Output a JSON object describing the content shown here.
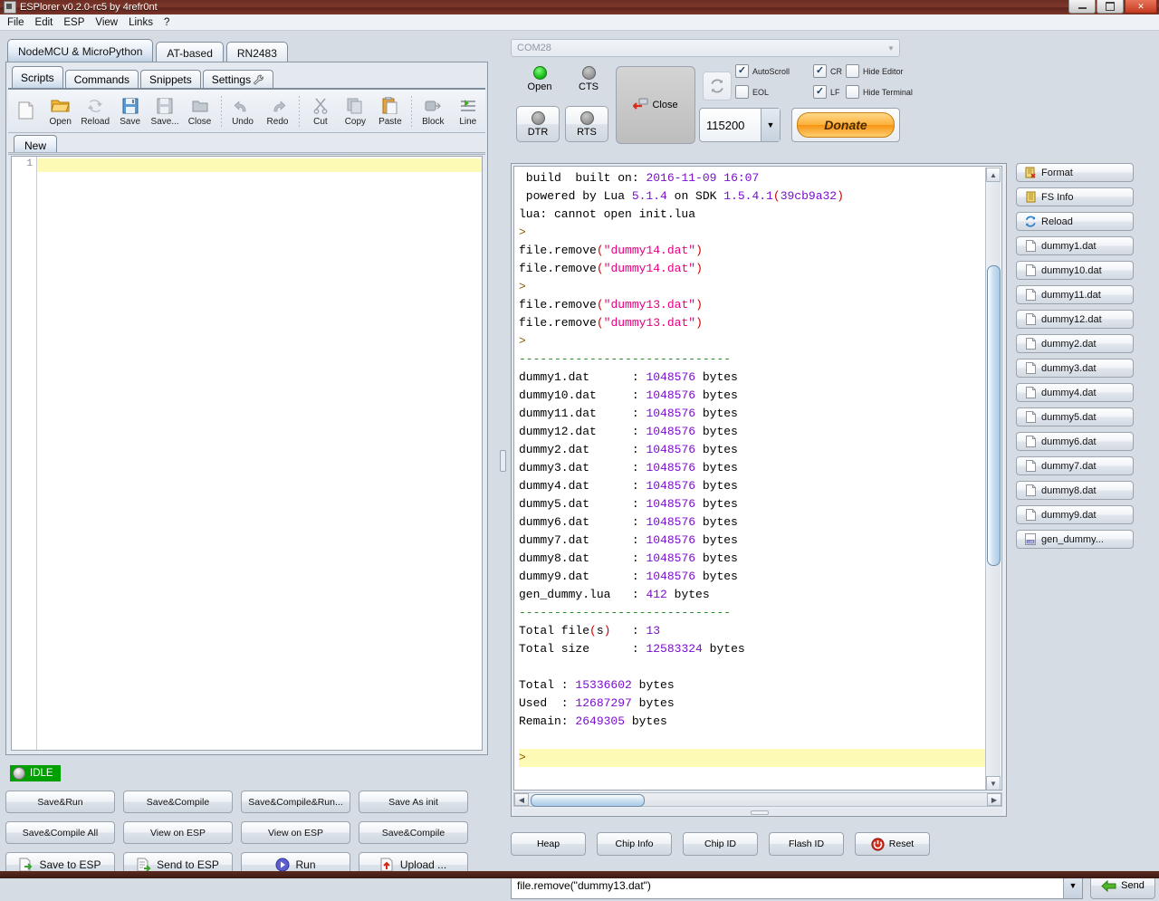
{
  "window": {
    "title": "ESPlorer v0.2.0-rc5 by 4refr0nt",
    "icon": "app-icon",
    "minimize": "minimize-button",
    "maximize": "maximize-button",
    "close": "close-button"
  },
  "menu": {
    "items": [
      "File",
      "Edit",
      "ESP",
      "View",
      "Links",
      "?"
    ]
  },
  "left": {
    "top_tabs": [
      {
        "label": "NodeMCU & MicroPython",
        "active": true
      },
      {
        "label": "AT-based",
        "active": false
      },
      {
        "label": "RN2483",
        "active": false
      }
    ],
    "sub_tabs": [
      {
        "label": "Scripts",
        "active": true
      },
      {
        "label": "Commands",
        "active": false
      },
      {
        "label": "Snippets",
        "active": false
      },
      {
        "label": "Settings",
        "active": false,
        "icon": "wrench-icon"
      }
    ],
    "toolbar": [
      {
        "label": "",
        "icon": "new-file-icon"
      },
      {
        "label": "Open",
        "icon": "open-folder-icon"
      },
      {
        "label": "Reload",
        "icon": "reload-icon"
      },
      {
        "label": "Save",
        "icon": "floppy-save-icon"
      },
      {
        "label": "Save...",
        "icon": "save-as-icon"
      },
      {
        "label": "Close",
        "icon": "close-file-icon"
      },
      {
        "label": "Undo",
        "icon": "undo-arrow-icon"
      },
      {
        "label": "Redo",
        "icon": "redo-arrow-icon"
      },
      {
        "label": "Cut",
        "icon": "scissors-icon"
      },
      {
        "label": "Copy",
        "icon": "copy-icon"
      },
      {
        "label": "Paste",
        "icon": "clipboard-paste-icon"
      },
      {
        "label": "Block",
        "icon": "block-icon"
      },
      {
        "label": "Line",
        "icon": "line-icon"
      }
    ],
    "editor_tabs": [
      {
        "label": "New",
        "active": true
      }
    ],
    "editor": {
      "line_numbers": [
        "1"
      ],
      "content": ""
    },
    "status": {
      "label": "IDLE",
      "color": "#00a000",
      "indicator": "status-led"
    },
    "buttons_row1": [
      "Save&Run",
      "Save&Compile",
      "Save&Compile&Run...",
      "Save As init"
    ],
    "buttons_row2": [
      "Save&Compile All",
      "View on ESP",
      "View on ESP",
      "Save&Compile"
    ],
    "buttons_row3": [
      {
        "label": "Save to ESP",
        "icon": "save-to-esp-icon"
      },
      {
        "label": "Send to ESP",
        "icon": "send-to-esp-icon",
        "mnemonic": "e"
      },
      {
        "label": "Run",
        "icon": "run-play-icon"
      },
      {
        "label": "Upload ...",
        "icon": "upload-icon"
      }
    ]
  },
  "right": {
    "port": {
      "value": "COM28",
      "arrow": "chevron-down-icon"
    },
    "leds": [
      {
        "label": "Open",
        "state": "on"
      },
      {
        "label": "CTS",
        "state": "off"
      }
    ],
    "toggle_buttons": [
      {
        "label": "DTR",
        "state": "off"
      },
      {
        "label": "RTS",
        "state": "off"
      }
    ],
    "close_button": {
      "label": "Close",
      "icon": "disconnect-icon"
    },
    "refresh_button": {
      "icon": "refresh-icon"
    },
    "checkboxes": [
      {
        "label": "AutoScroll",
        "checked": true
      },
      {
        "label": "EOL",
        "checked": false
      },
      {
        "label": "CR",
        "checked": true
      },
      {
        "label": "LF",
        "checked": true
      },
      {
        "label": "Hide Editor",
        "checked": false
      },
      {
        "label": "Hide Terminal",
        "checked": false
      }
    ],
    "baud": {
      "value": "115200",
      "arrow": "chevron-down-icon"
    },
    "donate": {
      "label": "Donate"
    },
    "terminal": {
      "lines": [
        " build  built on: 2016-11-09 16:07",
        " powered by Lua 5.1.4 on SDK 1.5.4.1(39cb9a32)",
        "lua: cannot open init.lua",
        ">",
        "file.remove(\"dummy14.dat\")",
        "file.remove(\"dummy14.dat\")",
        ">",
        "file.remove(\"dummy13.dat\")",
        "file.remove(\"dummy13.dat\")",
        ">",
        "------------------------------",
        "dummy1.dat      : 1048576 bytes",
        "dummy10.dat     : 1048576 bytes",
        "dummy11.dat     : 1048576 bytes",
        "dummy12.dat     : 1048576 bytes",
        "dummy2.dat      : 1048576 bytes",
        "dummy3.dat      : 1048576 bytes",
        "dummy4.dat      : 1048576 bytes",
        "dummy5.dat      : 1048576 bytes",
        "dummy6.dat      : 1048576 bytes",
        "dummy7.dat      : 1048576 bytes",
        "dummy8.dat      : 1048576 bytes",
        "dummy9.dat      : 1048576 bytes",
        "gen_dummy.lua   : 412 bytes",
        "------------------------------",
        "Total file(s)   : 13",
        "Total size      : 12583324 bytes",
        "",
        "Total : 15336602 bytes",
        "Used  : 12687297 bytes",
        "Remain: 2649305 bytes",
        "",
        ">"
      ]
    },
    "file_buttons": [
      {
        "label": "Format",
        "icon": "format-icon"
      },
      {
        "label": "FS Info",
        "icon": "fs-info-icon"
      },
      {
        "label": "Reload",
        "icon": "reload-blue-icon"
      },
      {
        "label": "dummy1.dat",
        "icon": "file-icon"
      },
      {
        "label": "dummy10.dat",
        "icon": "file-icon"
      },
      {
        "label": "dummy11.dat",
        "icon": "file-icon"
      },
      {
        "label": "dummy12.dat",
        "icon": "file-icon"
      },
      {
        "label": "dummy2.dat",
        "icon": "file-icon"
      },
      {
        "label": "dummy3.dat",
        "icon": "file-icon"
      },
      {
        "label": "dummy4.dat",
        "icon": "file-icon"
      },
      {
        "label": "dummy5.dat",
        "icon": "file-icon"
      },
      {
        "label": "dummy6.dat",
        "icon": "file-icon"
      },
      {
        "label": "dummy7.dat",
        "icon": "file-icon"
      },
      {
        "label": "dummy8.dat",
        "icon": "file-icon"
      },
      {
        "label": "dummy9.dat",
        "icon": "file-icon"
      },
      {
        "label": "gen_dummy...",
        "icon": "lua-file-icon"
      }
    ],
    "command_buttons": [
      {
        "label": "Heap",
        "icon": ""
      },
      {
        "label": "Chip Info",
        "icon": ""
      },
      {
        "label": "Chip ID",
        "icon": ""
      },
      {
        "label": "Flash ID",
        "icon": ""
      },
      {
        "label": "Reset",
        "icon": "power-reset-icon"
      }
    ],
    "command_line": {
      "value": "file.remove(\"dummy13.dat\")",
      "arrow": "chevron-down-icon"
    },
    "send_button": {
      "label": "Send",
      "icon": "send-arrow-icon"
    }
  },
  "colors": {
    "title_bar": "#6d2d23",
    "accent_number": "#7a0ecc",
    "accent_string": "#e4007f",
    "status_green": "#00a000",
    "donate_orange": "#fcb03a"
  }
}
